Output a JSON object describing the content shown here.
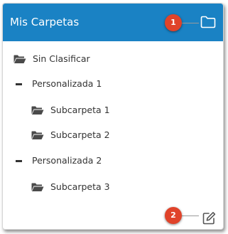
{
  "panel": {
    "title": "Mis Carpetas",
    "header_icon": "folder-outline-icon",
    "accent_color": "#1a82c4"
  },
  "callouts": [
    {
      "number": "1",
      "color": "#e0432a"
    },
    {
      "number": "2",
      "color": "#e0432a"
    }
  ],
  "tree": {
    "items": [
      {
        "label": "Sin Clasificar",
        "icon": "folder-open-icon",
        "level": 0
      },
      {
        "label": "Personalizada 1",
        "icon": "collapse-icon",
        "level": 0
      },
      {
        "label": "Subcarpeta 1",
        "icon": "folder-open-icon",
        "level": 1
      },
      {
        "label": "Subcarpeta 2",
        "icon": "folder-open-icon",
        "level": 1
      },
      {
        "label": "Personalizada 2",
        "icon": "collapse-icon",
        "level": 0
      },
      {
        "label": "Subcarpeta 3",
        "icon": "folder-open-icon",
        "level": 1
      }
    ]
  },
  "footer": {
    "edit_icon": "edit-icon"
  }
}
